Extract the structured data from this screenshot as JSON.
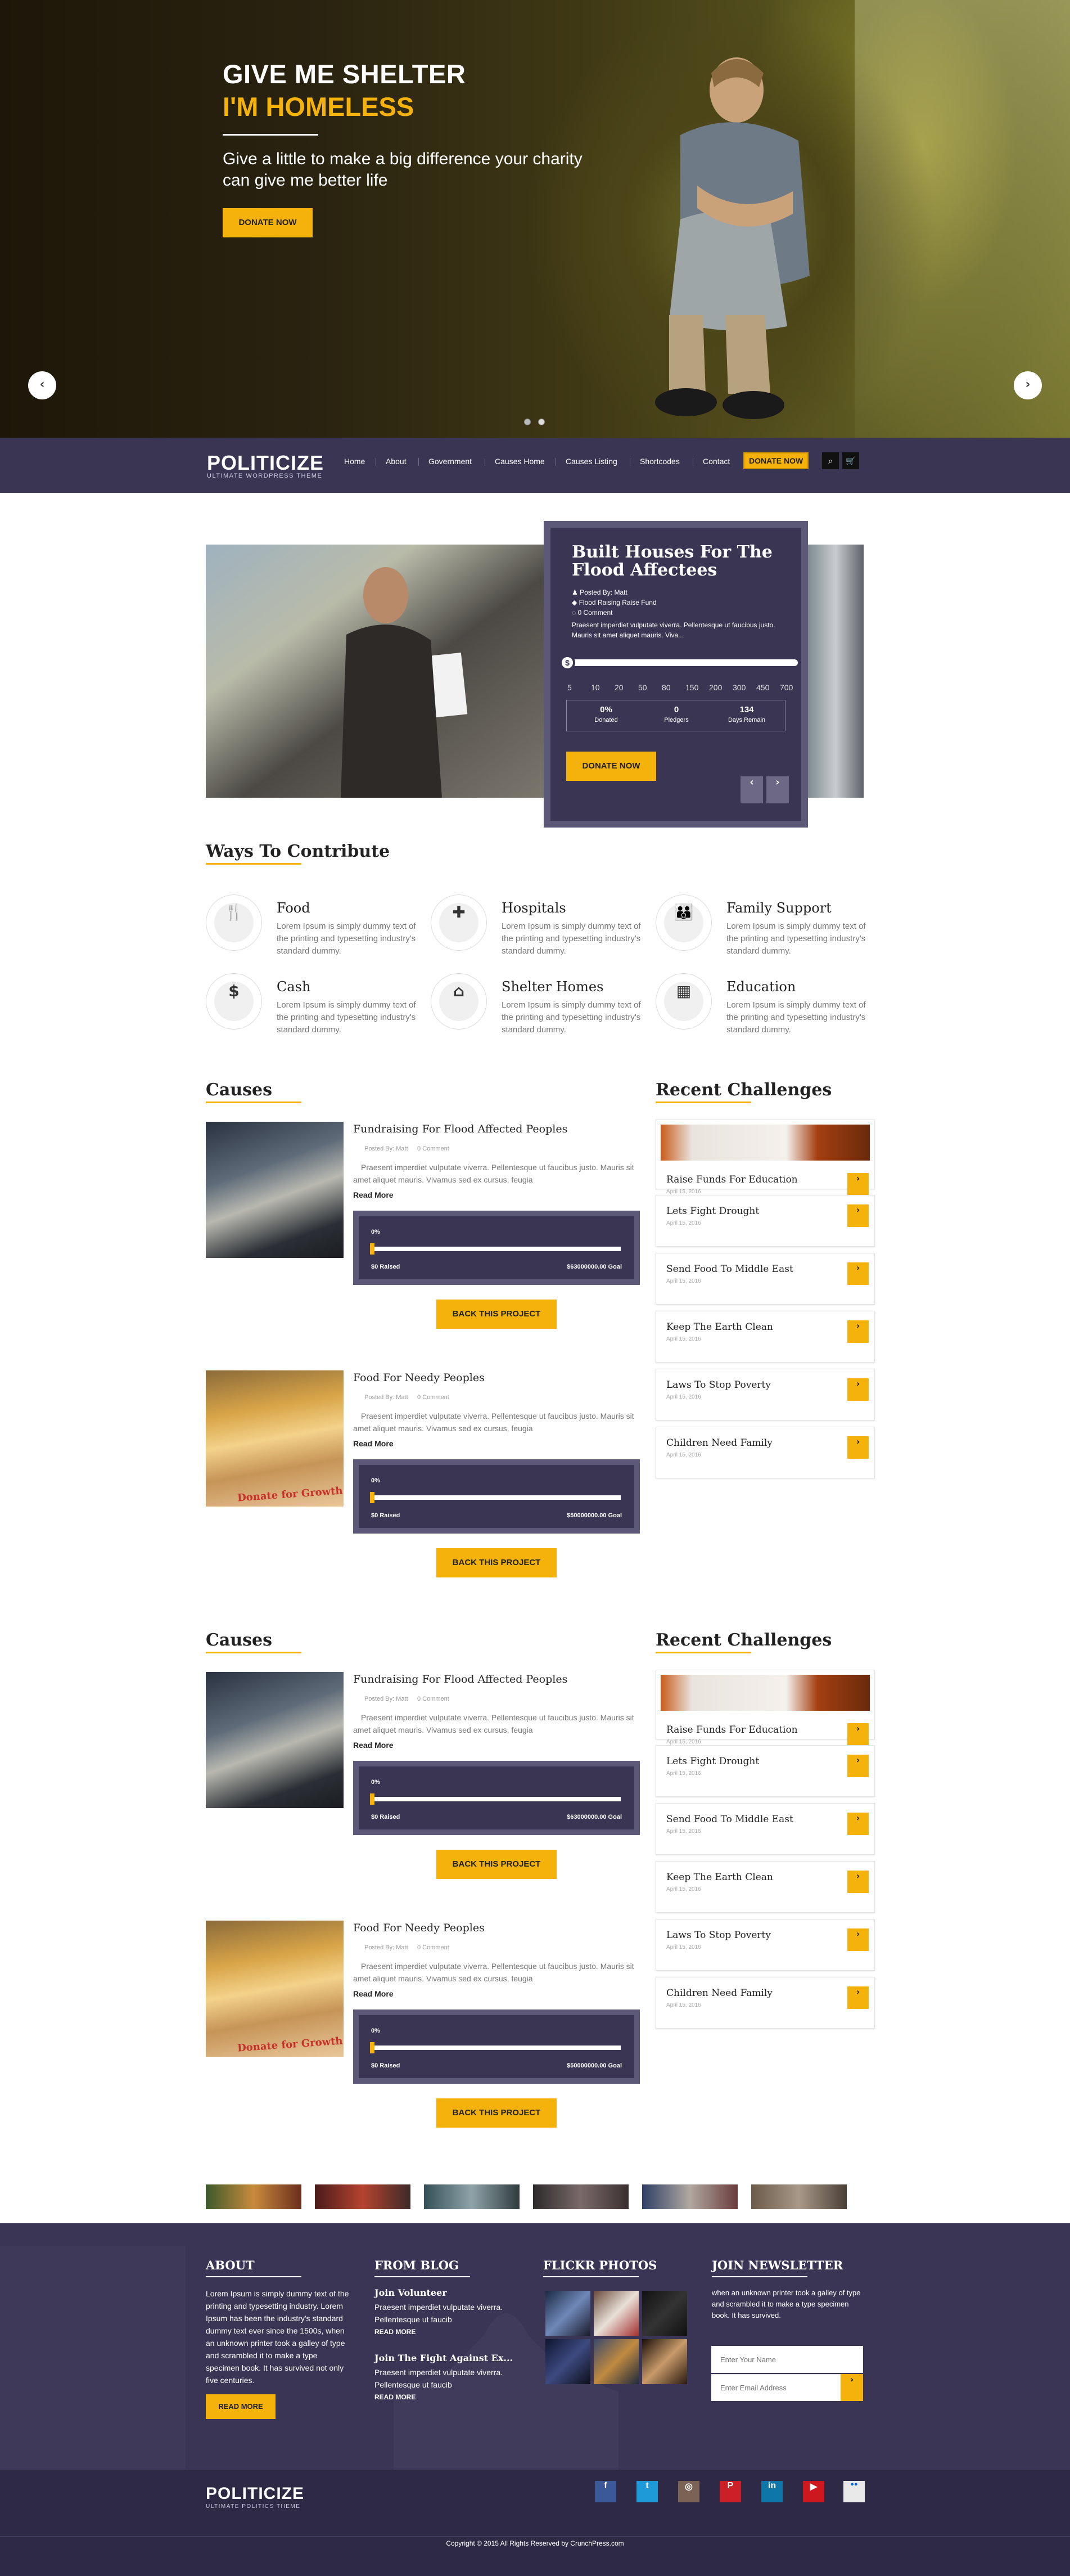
{
  "hero": {
    "title_line1": "GIVE ME SHELTER",
    "title_line2": "I'M HOMELESS",
    "subtitle": "Give a little to make a big difference your charity can give me better life",
    "cta": "DONATE NOW",
    "prev": "‹",
    "next": "›"
  },
  "nav": {
    "logo": "POLITICIZE",
    "logo_sub": "ULTIMATE WORDPRESS THEME",
    "items": [
      "Home",
      "About",
      "Government",
      "Causes Home",
      "Causes Listing",
      "Shortcodes",
      "Contact"
    ],
    "donate": "DONATE NOW",
    "search_icon": "search-icon",
    "cart_icon": "cart-icon"
  },
  "featured": {
    "title": "Built Houses For The Flood Affectees",
    "posted_by": "Posted By: Matt",
    "category": "Flood Raising Raise Fund",
    "comments": "0 Comment",
    "excerpt": "Praesent imperdiet vulputate viverra. Pellentesque ut faucibus justo. Mauris sit amet aliquet mauris. Viva...",
    "knob": "$",
    "ticks": [
      "5",
      "10",
      "20",
      "50",
      "80",
      "150",
      "200",
      "300",
      "450",
      "700"
    ],
    "stats": [
      {
        "value": "0%",
        "label": "Donated"
      },
      {
        "value": "0",
        "label": "Pledgers"
      },
      {
        "value": "134",
        "label": "Days Remain"
      }
    ],
    "cta": "DONATE NOW",
    "prev": "‹",
    "next": "›"
  },
  "ways": {
    "heading": "Ways To Contribute",
    "items": [
      {
        "icon": "utensils-icon",
        "glyph": "🍴",
        "title": "Food",
        "text": "Lorem Ipsum is simply dummy text of the printing and typesetting industry's standard dummy."
      },
      {
        "icon": "ambulance-icon",
        "glyph": "✚",
        "title": "Hospitals",
        "text": "Lorem Ipsum is simply dummy text of the printing and typesetting industry's standard dummy."
      },
      {
        "icon": "users-icon",
        "glyph": "👪",
        "title": "Family Support",
        "text": "Lorem Ipsum is simply dummy text of the printing and typesetting industry's standard dummy."
      },
      {
        "icon": "dollar-icon",
        "glyph": "$",
        "title": "Cash",
        "text": "Lorem Ipsum is simply dummy text of the printing and typesetting industry's standard dummy."
      },
      {
        "icon": "home-icon",
        "glyph": "⌂",
        "title": "Shelter Homes",
        "text": "Lorem Ipsum is simply dummy text of the printing and typesetting industry's standard dummy."
      },
      {
        "icon": "calendar-icon",
        "glyph": "▦",
        "title": "Education",
        "text": "Lorem Ipsum is simply dummy text of the printing and typesetting industry's standard dummy."
      }
    ]
  },
  "causes": {
    "heading": "Causes",
    "items": [
      {
        "title": "Fundraising For Flood Affected Peoples",
        "posted": "Posted By: Matt",
        "comments": "0 Comment",
        "text": "Praesent imperdiet vulputate viverra. Pellentesque ut faucibus justo. Mauris sit amet aliquet mauris. Vivamus sed ex cursus, feugia",
        "readmore": "Read More",
        "pct": "0%",
        "raised": "$0 Raised",
        "goal": "$63000000.00 Goal",
        "back": "BACK THIS PROJECT"
      },
      {
        "title": "Food For Needy Peoples",
        "posted": "Posted By: Matt",
        "comments": "0 Comment",
        "text": "Praesent imperdiet vulputate viverra. Pellentesque ut faucibus justo. Mauris sit amet aliquet mauris. Vivamus sed ex cursus, feugia",
        "readmore": "Read More",
        "pct": "0%",
        "raised": "$0 Raised",
        "goal": "$50000000.00 Goal",
        "back": "BACK THIS PROJECT",
        "img_caption": "Donate for Growth"
      }
    ]
  },
  "challenges": {
    "heading": "Recent Challenges",
    "items": [
      {
        "title": "Raise Funds For Education",
        "date": "April 15, 2016"
      },
      {
        "title": "Lets Fight Drought",
        "date": "April 15, 2016"
      },
      {
        "title": "Send Food To Middle East",
        "date": "April 15, 2016"
      },
      {
        "title": "Keep The Earth Clean",
        "date": "April 15, 2016"
      },
      {
        "title": "Laws To Stop Poverty",
        "date": "April 15, 2016"
      },
      {
        "title": "Children Need Family",
        "date": "April 15, 2016"
      }
    ]
  },
  "footer": {
    "about_h": "ABOUT",
    "about_text": "Lorem Ipsum is simply dummy text of the printing and typesetting industry. Lorem Ipsum has been the industry's standard dummy text ever since the 1500s, when an unknown printer took a galley of type and scrambled it to make a type specimen book. It has survived not only five centuries.",
    "about_btn": "READ MORE",
    "blog_h": "FROM BLOG",
    "blog": [
      {
        "title": "Join Volunteer",
        "text": "Praesent imperdiet vulputate viverra. Pellentesque ut faucib",
        "rm": "READ MORE"
      },
      {
        "title": "Join The Fight Against Ex...",
        "text": "Praesent imperdiet vulputate viverra. Pellentesque ut faucib",
        "rm": "READ MORE"
      }
    ],
    "flickr_h": "FLICKR PHOTOS",
    "news_h": "JOIN NEWSLETTER",
    "news_text": "when an unknown printer took a galley of type and scrambled it to make a type specimen book. It has survived.",
    "name_ph": "Enter Your Name",
    "email_ph": "Enter Email Address",
    "go": "›",
    "logo": "POLITICIZE",
    "logo_sub": "ULTIMATE POLITICS THEME",
    "social": [
      "f",
      "t",
      "◎",
      "P",
      "in",
      "▶",
      "●●"
    ],
    "copyright": "Copyright © 2015 All Rights Reserved by CrunchPress.com"
  },
  "colors": {
    "accent": "#f5b20b",
    "navy": "#393553"
  }
}
